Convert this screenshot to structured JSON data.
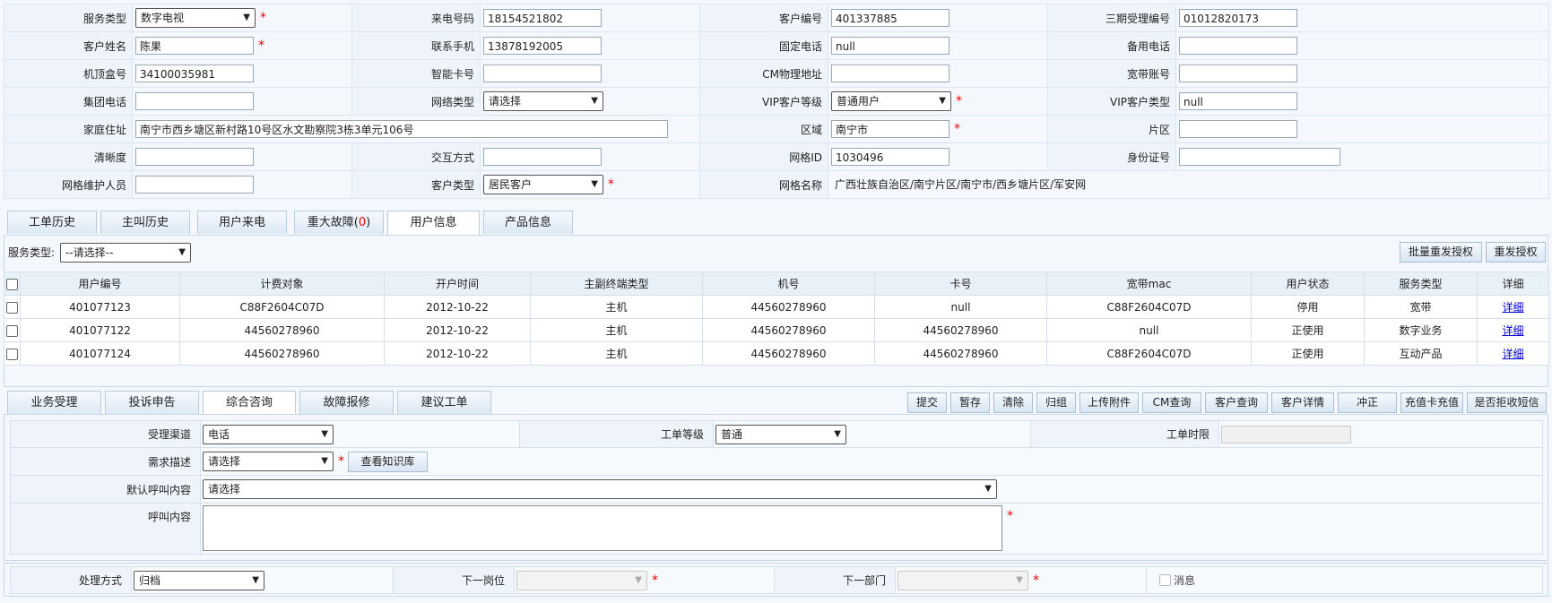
{
  "customer_form": {
    "service_type": {
      "label": "服务类型",
      "value": "数字电视"
    },
    "caller_number": {
      "label": "来电号码",
      "value": "18154521802"
    },
    "customer_no": {
      "label": "客户编号",
      "value": "401337885"
    },
    "phase3_accept_no": {
      "label": "三期受理编号",
      "value": "01012820173"
    },
    "customer_name": {
      "label": "客户姓名",
      "value": "陈果"
    },
    "contact_mobile": {
      "label": "联系手机",
      "value": "13878192005"
    },
    "fixed_phone": {
      "label": "固定电话",
      "value": "null"
    },
    "backup_phone": {
      "label": "备用电话",
      "value": ""
    },
    "stb_no": {
      "label": "机顶盒号",
      "value": "34100035981"
    },
    "smart_card": {
      "label": "智能卡号",
      "value": ""
    },
    "cm_physical_addr": {
      "label": "CM物理地址",
      "value": ""
    },
    "broadband_account": {
      "label": "宽带账号",
      "value": ""
    },
    "group_phone": {
      "label": "集团电话",
      "value": ""
    },
    "network_type": {
      "label": "网络类型",
      "value": "请选择"
    },
    "vip_level": {
      "label": "VIP客户等级",
      "value": "普通用户"
    },
    "vip_type": {
      "label": "VIP客户类型",
      "value": "null"
    },
    "home_address": {
      "label": "家庭住址",
      "value": "南宁市西乡塘区新村路10号区水文勘察院3栋3单元106号"
    },
    "area": {
      "label": "区域",
      "value": "南宁市"
    },
    "zone": {
      "label": "片区",
      "value": ""
    },
    "definition": {
      "label": "清晰度",
      "value": ""
    },
    "interaction_mode": {
      "label": "交互方式",
      "value": ""
    },
    "grid_id": {
      "label": "网格ID",
      "value": "1030496"
    },
    "id_card": {
      "label": "身份证号",
      "value": ""
    },
    "grid_maintainer": {
      "label": "网格维护人员",
      "value": ""
    },
    "customer_type": {
      "label": "客户类型",
      "value": "居民客户"
    },
    "grid_name": {
      "label": "网格名称",
      "value": "广西壮族自治区/南宁片区/南宁市/西乡塘片区/军安网"
    }
  },
  "info_tabs": [
    {
      "label": "工单历史"
    },
    {
      "label": "主叫历史"
    },
    {
      "label": "用户来电"
    },
    {
      "label": "重大故障(",
      "count": "0",
      "suffix": ")"
    },
    {
      "label": "用户信息"
    },
    {
      "label": "产品信息"
    }
  ],
  "user_panel": {
    "service_type_label": "服务类型:",
    "service_type_value": "--请选择--",
    "batch_resend_button": "批量重发授权",
    "resend_button": "重发授权"
  },
  "user_table": {
    "headers": [
      "用户编号",
      "计费对象",
      "开户时间",
      "主副终端类型",
      "机号",
      "卡号",
      "宽带mac",
      "用户状态",
      "服务类型",
      "详细"
    ],
    "rows": [
      [
        "401077123",
        "C88F2604C07D",
        "2012-10-22",
        "主机",
        "44560278960",
        "null",
        "C88F2604C07D",
        "停用",
        "宽带",
        "详细"
      ],
      [
        "401077122",
        "44560278960",
        "2012-10-22",
        "主机",
        "44560278960",
        "44560278960",
        "null",
        "正使用",
        "数字业务",
        "详细"
      ],
      [
        "401077124",
        "44560278960",
        "2012-10-22",
        "主机",
        "44560278960",
        "44560278960",
        "C88F2604C07D",
        "正使用",
        "互动产品",
        "详细"
      ]
    ]
  },
  "work_tabs": [
    {
      "label": "业务受理"
    },
    {
      "label": "投诉申告"
    },
    {
      "label": "综合咨询"
    },
    {
      "label": "故障报修"
    },
    {
      "label": "建议工单"
    }
  ],
  "actions": [
    "提交",
    "暂存",
    "清除",
    "归组",
    "上传附件",
    "CM查询",
    "客户查询",
    "客户详情",
    "冲正",
    "充值卡充值",
    "是否拒收短信"
  ],
  "consult_form": {
    "channel": {
      "label": "受理渠道",
      "value": "电话"
    },
    "ticket_level": {
      "label": "工单等级",
      "value": "普通"
    },
    "ticket_deadline": {
      "label": "工单时限",
      "value": ""
    },
    "requirement": {
      "label": "需求描述",
      "value": "请选择"
    },
    "knowledge_button": "查看知识库",
    "default_call_content": {
      "label": "默认呼叫内容",
      "value": "请选择"
    },
    "call_content": {
      "label": "呼叫内容",
      "value": ""
    }
  },
  "process_form": {
    "method": {
      "label": "处理方式",
      "value": "归档"
    },
    "next_post": {
      "label": "下一岗位",
      "value": ""
    },
    "next_dept": {
      "label": "下一部门",
      "value": ""
    },
    "message": {
      "label": "消息",
      "checked": false
    }
  }
}
